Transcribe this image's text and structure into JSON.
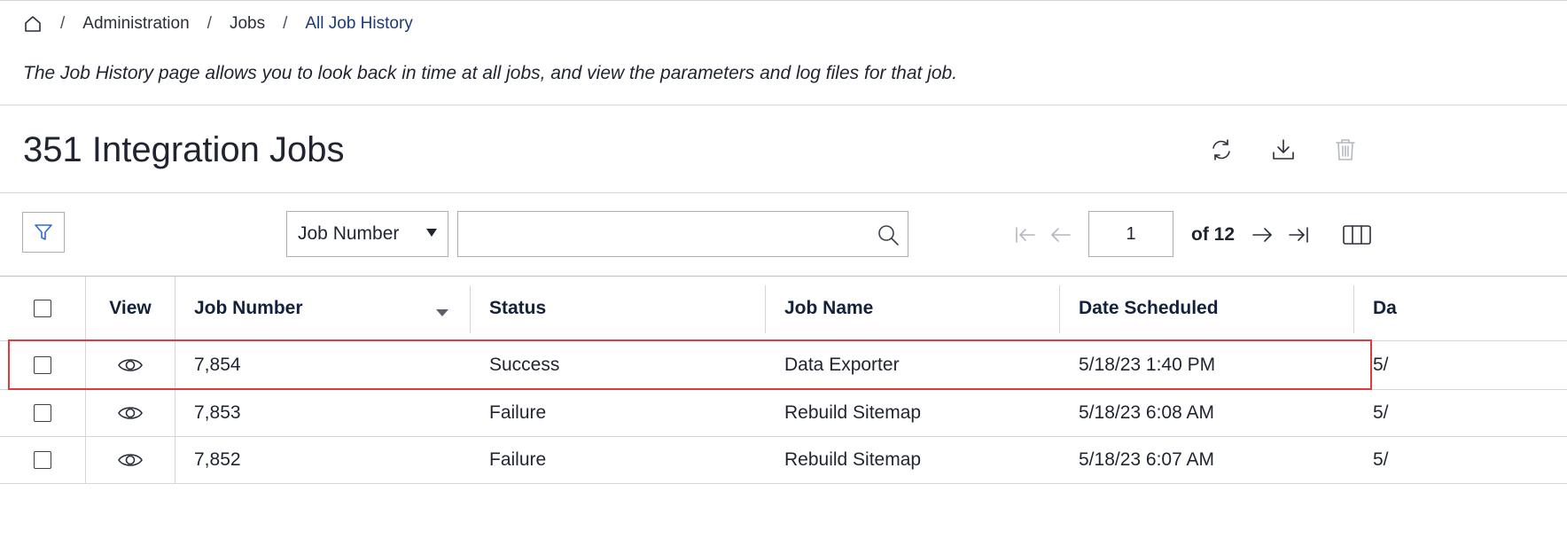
{
  "breadcrumb": {
    "items": [
      {
        "label": "Administration"
      },
      {
        "label": "Jobs"
      },
      {
        "label": "All Job History"
      }
    ],
    "separator": "/"
  },
  "description": "The Job History page allows you to look back in time at all jobs, and view the parameters and log files for that job.",
  "page_title": "351 Integration Jobs",
  "header_actions": {
    "icons": [
      "refresh-icon",
      "download-icon",
      "trash-icon"
    ]
  },
  "toolbar": {
    "search_field": "Job Number",
    "search_value": "",
    "page_current": "1",
    "page_of": "of 12"
  },
  "table": {
    "columns": {
      "view": "View",
      "job_number": "Job Number",
      "status": "Status",
      "job_name": "Job Name",
      "date_scheduled": "Date Scheduled",
      "next_partial": "Da"
    },
    "rows": [
      {
        "job_number": "7,854",
        "status": "Success",
        "job_name": "Data Exporter",
        "date_scheduled": "5/18/23 1:40 PM",
        "next_partial": "5/"
      },
      {
        "job_number": "7,853",
        "status": "Failure",
        "job_name": "Rebuild Sitemap",
        "date_scheduled": "5/18/23 6:08 AM",
        "next_partial": "5/"
      },
      {
        "job_number": "7,852",
        "status": "Failure",
        "job_name": "Rebuild Sitemap",
        "date_scheduled": "5/18/23 6:07 AM",
        "next_partial": "5/"
      }
    ]
  },
  "colors": {
    "highlight": "#e0393e",
    "link_blue": "#1d3b7a",
    "filter_icon_blue": "#2f6bd1"
  }
}
